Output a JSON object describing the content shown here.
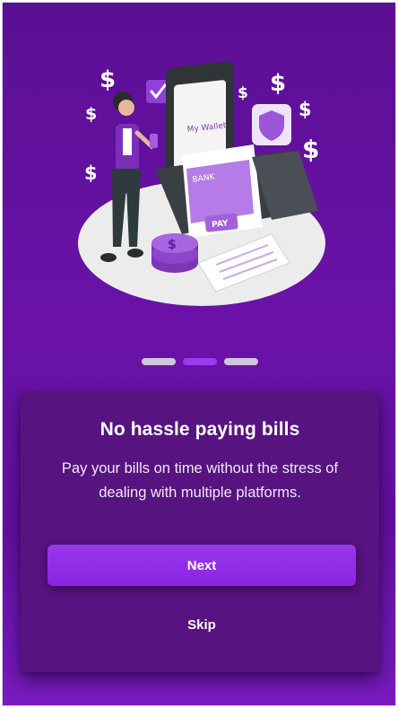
{
  "onboarding": {
    "title": "No hassle paying bills",
    "description": "Pay your bills on time without the stress of dealing with multiple platforms.",
    "next_label": "Next",
    "skip_label": "Skip",
    "illustration": {
      "wallet_label": "My Wallet",
      "card_label": "BANK",
      "pay_label": "PAY"
    },
    "pager": {
      "count": 3,
      "active_index": 1
    }
  },
  "colors": {
    "background": "#6a12a8",
    "card": "#57137f",
    "accent": "#9a36ee",
    "dot_inactive": "#cfc6de"
  }
}
